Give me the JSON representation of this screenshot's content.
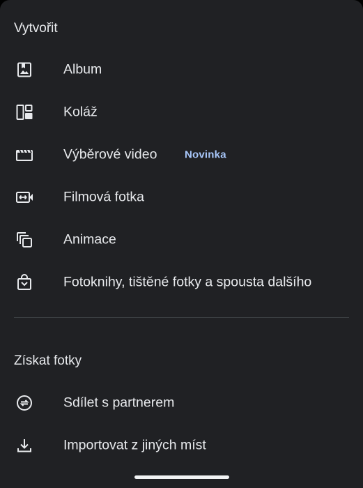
{
  "create_section": {
    "title": "Vytvořit",
    "items": [
      {
        "label": "Album",
        "icon": "album-icon"
      },
      {
        "label": "Koláž",
        "icon": "collage-icon"
      },
      {
        "label": "Výběrové video",
        "icon": "highlight-video-icon",
        "badge": "Novinka"
      },
      {
        "label": "Filmová fotka",
        "icon": "cinematic-photo-icon"
      },
      {
        "label": "Animace",
        "icon": "animation-icon"
      },
      {
        "label": "Fotoknihy, tištěné fotky a spousta dalšího",
        "icon": "print-store-icon"
      }
    ]
  },
  "get_photos_section": {
    "title": "Získat fotky",
    "items": [
      {
        "label": "Sdílet s partnerem",
        "icon": "partner-sharing-icon"
      },
      {
        "label": "Importovat z jiných míst",
        "icon": "import-icon"
      }
    ]
  },
  "colors": {
    "background": "#202124",
    "text": "#e8eaed",
    "badge": "#a8c7fa",
    "divider": "#3c4043"
  }
}
